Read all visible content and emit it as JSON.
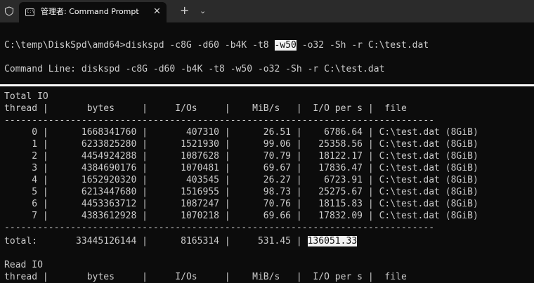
{
  "titlebar": {
    "tab_title": "管理者: Command Prompt",
    "close_glyph": "✕",
    "new_tab_glyph": "+",
    "dropdown_glyph": "⌄"
  },
  "console": {
    "command_prefix": "C:\\temp\\DiskSpd\\amd64>diskspd -c8G -d60 -b4K -t8 ",
    "command_highlight": "-w50",
    "command_suffix": " -o32 -Sh -r C:\\test.dat",
    "command_line_echo": "Command Line: diskspd -c8G -d60 -b4K -t8 -w50 -o32 -Sh -r C:\\test.dat",
    "total_io_title": "Total IO",
    "header": "thread |       bytes     |     I/Os     |    MiB/s   |  I/O per s |  file",
    "divider": "------------------------------------------------------------------------------",
    "rows": [
      "     0 |      1668341760 |       407310 |      26.51 |    6786.64 | C:\\test.dat (8GiB)",
      "     1 |      6233825280 |      1521930 |      99.06 |   25358.56 | C:\\test.dat (8GiB)",
      "     2 |      4454924288 |      1087628 |      70.79 |   18122.17 | C:\\test.dat (8GiB)",
      "     3 |      4384690176 |      1070481 |      69.67 |   17836.47 | C:\\test.dat (8GiB)",
      "     4 |      1652920320 |       403545 |      26.27 |    6723.91 | C:\\test.dat (8GiB)",
      "     5 |      6213447680 |      1516955 |      98.73 |   25275.67 | C:\\test.dat (8GiB)",
      "     6 |      4453363712 |      1087247 |      70.76 |   18115.83 | C:\\test.dat (8GiB)",
      "     7 |      4383612928 |      1070218 |      69.66 |   17832.09 | C:\\test.dat (8GiB)"
    ],
    "total_prefix": "total:       33445126144 |      8165314 |     531.45 | ",
    "total_highlight": "136051.33",
    "read_io_title": "Read IO",
    "read_header": "thread |       bytes     |     I/Os     |    MiB/s   |  I/O per s |  file"
  }
}
